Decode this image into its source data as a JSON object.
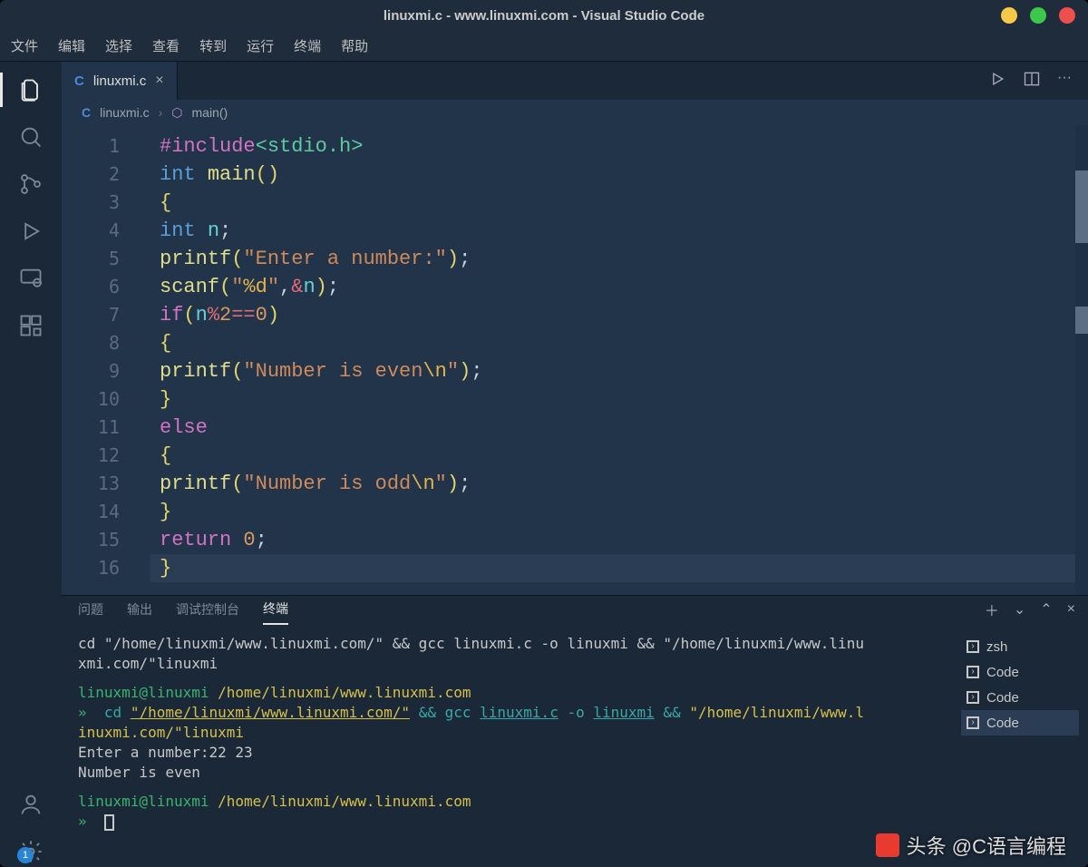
{
  "window": {
    "title": "linuxmi.c - www.linuxmi.com - Visual Studio Code"
  },
  "menu": [
    "文件",
    "编辑",
    "选择",
    "查看",
    "转到",
    "运行",
    "终端",
    "帮助"
  ],
  "tab": {
    "icon": "C",
    "label": "linuxmi.c"
  },
  "breadcrumb": {
    "icon": "C",
    "file": "linuxmi.c",
    "symbol": "main()"
  },
  "code": {
    "lines": [
      [
        {
          "c": "tk-mag",
          "t": "#include"
        },
        {
          "c": "tk-grn",
          "t": "<stdio.h>"
        }
      ],
      [
        {
          "c": "tk-blu",
          "t": "int "
        },
        {
          "c": "tk-fn",
          "t": "main"
        },
        {
          "c": "tk-yel",
          "t": "()"
        }
      ],
      [
        {
          "c": "tk-yel",
          "t": "{"
        }
      ],
      [
        {
          "c": "tk-blu",
          "t": "int "
        },
        {
          "c": "tk-cyn",
          "t": "n"
        },
        {
          "c": "tk-w",
          "t": ";"
        }
      ],
      [
        {
          "c": "tk-fn",
          "t": "printf"
        },
        {
          "c": "tk-yel",
          "t": "("
        },
        {
          "c": "tk-str",
          "t": "\"Enter a number:\""
        },
        {
          "c": "tk-yel",
          "t": ")"
        },
        {
          "c": "tk-w",
          "t": ";"
        }
      ],
      [
        {
          "c": "tk-fn",
          "t": "scanf"
        },
        {
          "c": "tk-yel",
          "t": "("
        },
        {
          "c": "tk-str",
          "t": "\""
        },
        {
          "c": "tk-esc",
          "t": "%d"
        },
        {
          "c": "tk-str",
          "t": "\""
        },
        {
          "c": "tk-w",
          "t": ","
        },
        {
          "c": "tk-red",
          "t": "&"
        },
        {
          "c": "tk-cyn",
          "t": "n"
        },
        {
          "c": "tk-yel",
          "t": ")"
        },
        {
          "c": "tk-w",
          "t": ";"
        }
      ],
      [
        {
          "c": "tk-mag",
          "t": "if"
        },
        {
          "c": "tk-yel",
          "t": "("
        },
        {
          "c": "tk-cyn",
          "t": "n"
        },
        {
          "c": "tk-red",
          "t": "%"
        },
        {
          "c": "tk-num",
          "t": "2"
        },
        {
          "c": "tk-red",
          "t": "=="
        },
        {
          "c": "tk-num",
          "t": "0"
        },
        {
          "c": "tk-yel",
          "t": ")"
        }
      ],
      [
        {
          "c": "tk-yel",
          "t": "{"
        }
      ],
      [
        {
          "c": "tk-fn",
          "t": "printf"
        },
        {
          "c": "tk-yel",
          "t": "("
        },
        {
          "c": "tk-str",
          "t": "\"Number is even"
        },
        {
          "c": "tk-esc",
          "t": "\\n"
        },
        {
          "c": "tk-str",
          "t": "\""
        },
        {
          "c": "tk-yel",
          "t": ")"
        },
        {
          "c": "tk-w",
          "t": ";"
        }
      ],
      [
        {
          "c": "tk-yel",
          "t": "}"
        }
      ],
      [
        {
          "c": "tk-mag",
          "t": "else"
        }
      ],
      [
        {
          "c": "tk-yel",
          "t": "{"
        }
      ],
      [
        {
          "c": "tk-fn",
          "t": "printf"
        },
        {
          "c": "tk-yel",
          "t": "("
        },
        {
          "c": "tk-str",
          "t": "\"Number is odd"
        },
        {
          "c": "tk-esc",
          "t": "\\n"
        },
        {
          "c": "tk-str",
          "t": "\""
        },
        {
          "c": "tk-yel",
          "t": ")"
        },
        {
          "c": "tk-w",
          "t": ";"
        }
      ],
      [
        {
          "c": "tk-yel",
          "t": "}"
        }
      ],
      [
        {
          "c": "tk-mag",
          "t": "return "
        },
        {
          "c": "tk-num",
          "t": "0"
        },
        {
          "c": "tk-w",
          "t": ";"
        }
      ],
      [
        {
          "c": "tk-yel",
          "t": "}"
        }
      ]
    ],
    "highlightLine": 16
  },
  "panel": {
    "tabs": [
      "问题",
      "输出",
      "调试控制台",
      "终端"
    ],
    "activeTab": 3,
    "shells": [
      "zsh",
      "Code",
      "Code",
      "Code"
    ],
    "activeShell": 3
  },
  "terminal": {
    "l1a": "cd \"/home/linuxmi/www.linuxmi.com/\" && gcc linuxmi.c -o linuxmi && \"/home/linuxmi/www.linu",
    "l1b": "xmi.com/\"linuxmi",
    "prompt_user": "linuxmi@linuxmi ",
    "prompt_path": "/home/linuxmi/www.linuxmi.com",
    "l3a": "cd ",
    "l3b": "\"/home/linuxmi/www.linuxmi.com/\"",
    "l3c": " && ",
    "l3d": "gcc ",
    "l3e": "linuxmi.c",
    "l3f": " -o ",
    "l3g": "linuxmi",
    "l3h": " && ",
    "l3i": "\"/home/linuxmi/www.l",
    "l4": "inuxmi.com/\"linuxmi",
    "l5": "Enter a number:22 23",
    "l6": "Number is even"
  },
  "settings_badge": "1",
  "watermark": "头条 @C语言编程"
}
